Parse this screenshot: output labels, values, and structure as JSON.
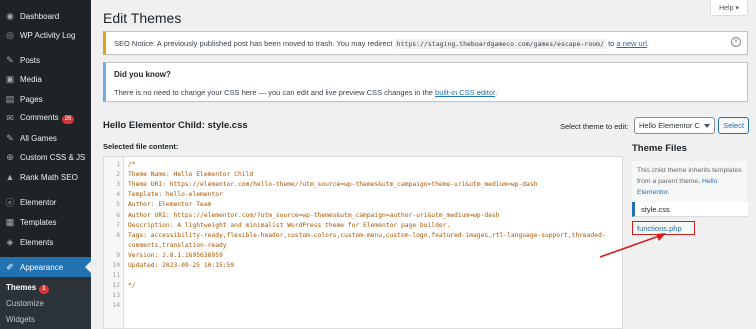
{
  "sidebar": {
    "items": [
      {
        "label": "Dashboard",
        "icon": "dashboard-icon",
        "glyph": "◉"
      },
      {
        "label": "WP Activity Log",
        "icon": "activity-log-icon",
        "glyph": "◎"
      },
      {
        "label": "Posts",
        "icon": "pin-icon",
        "glyph": "✎"
      },
      {
        "label": "Media",
        "icon": "media-icon",
        "glyph": "▣"
      },
      {
        "label": "Pages",
        "icon": "pages-icon",
        "glyph": "▤"
      },
      {
        "label": "Comments",
        "icon": "comments-icon",
        "glyph": "✉",
        "badge": "26"
      },
      {
        "label": "All Games",
        "icon": "pin-icon",
        "glyph": "✎"
      },
      {
        "label": "Custom CSS & JS",
        "icon": "plus-icon",
        "glyph": "⊕"
      },
      {
        "label": "Rank Math SEO",
        "icon": "rank-math-icon",
        "glyph": "▲"
      },
      {
        "label": "Elementor",
        "icon": "elementor-icon",
        "glyph": "ⓔ"
      },
      {
        "label": "Templates",
        "icon": "templates-icon",
        "glyph": "▦"
      },
      {
        "label": "Elements",
        "icon": "elements-icon",
        "glyph": "◈"
      },
      {
        "label": "Appearance",
        "icon": "appearance-icon",
        "glyph": "✐"
      }
    ],
    "submenu": [
      {
        "label": "Themes",
        "badge": "1"
      },
      {
        "label": "Customize"
      },
      {
        "label": "Widgets"
      }
    ]
  },
  "header": {
    "title": "Edit Themes",
    "help_label": "Help ▾"
  },
  "seo_notice": {
    "label": "SEO Notice:",
    "text": " A previously published post has been moved to trash. You may redirect ",
    "url": "https://staging.theboardgameco.com/games/escape-room/",
    "to": " to ",
    "link": "a new url",
    "end": "."
  },
  "info_notice": {
    "title": "Did you know?",
    "text": "There is no need to change your CSS here — you can edit and live preview CSS changes in the ",
    "link": "built-in CSS editor",
    "end": "."
  },
  "editor": {
    "file_heading": "Hello Elementor Child: style.css",
    "select_label": "Select theme to edit:",
    "select_value": "Hello Elementor C",
    "select_button": "Select",
    "selected_file_label": "Selected file content:",
    "lines": [
      {
        "n": "1",
        "text": "/*"
      },
      {
        "n": "2",
        "text": "Theme Name: Hello Elementor Child"
      },
      {
        "n": "3",
        "text": "Theme URI: https://elementor.com/hello-theme/?utm_source=wp-themes&utm_campaign=theme-uri&utm_medium=wp-dash"
      },
      {
        "n": "4",
        "text": "Template: hello-elementor"
      },
      {
        "n": "5",
        "text": "Author: Elementor Team"
      },
      {
        "n": "6",
        "text": "Author URI: https://elementor.com/?utm_source=wp-themes&utm_campaign=author-uri&utm_medium=wp-dash"
      },
      {
        "n": "7",
        "text": "Description: A lightweight and minimalist WordPress theme for Elementor page builder."
      },
      {
        "n": "8",
        "text": "Tags: accessibility-ready,flexible-header,custom-colors,custom-menu,custom-logo,featured-images,rtl-language-support,threaded-"
      },
      {
        "n": "",
        "text": "comments,translation-ready"
      },
      {
        "n": "9",
        "text": "Version: 2.8.1.1695636959"
      },
      {
        "n": "10",
        "text": "Updated: 2023-09-25 10:15:59"
      },
      {
        "n": "11",
        "text": ""
      },
      {
        "n": "12",
        "text": "*/"
      },
      {
        "n": "13",
        "text": ""
      },
      {
        "n": "14",
        "text": ""
      }
    ]
  },
  "theme_files": {
    "title": "Theme Files",
    "desc": "This child theme inherits templates from a parent theme, ",
    "desc_link": "Hello Elementor",
    "desc_end": ".",
    "files": [
      "style.css",
      "functions.php"
    ]
  },
  "colors": {
    "sidebar_bg": "#1d2327",
    "accent": "#2271b1",
    "highlight": "#d11f1f"
  }
}
